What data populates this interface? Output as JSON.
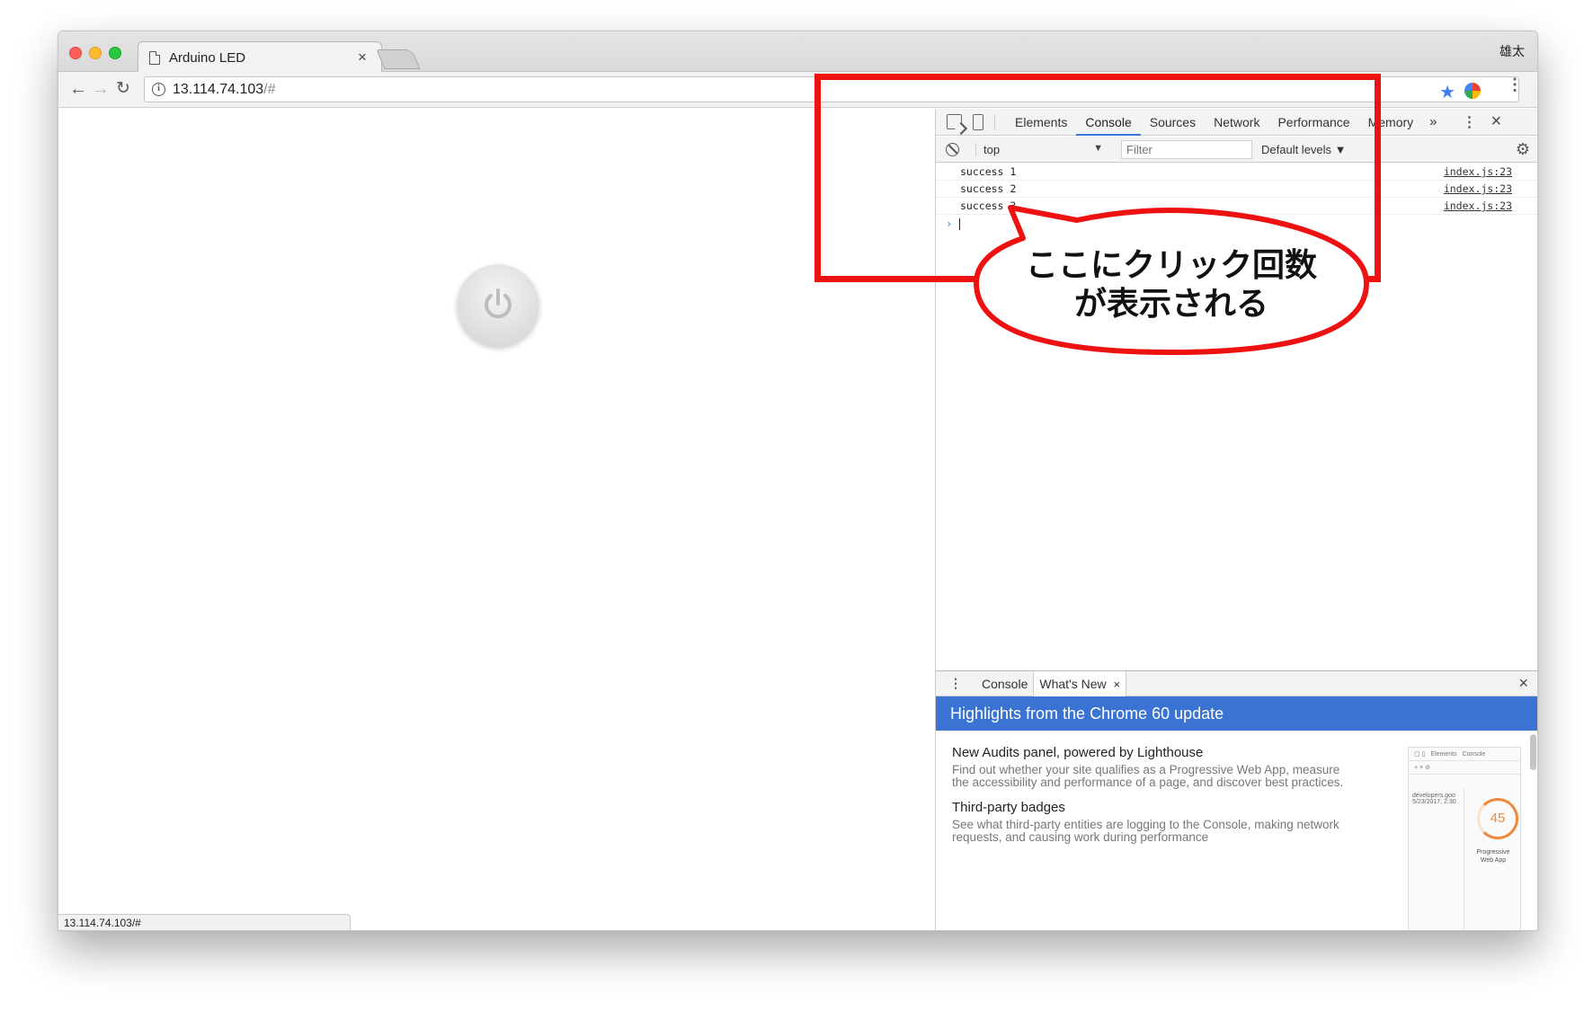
{
  "browser": {
    "tab_title": "Arduino LED",
    "tab_close": "×",
    "profile_name": "雄太",
    "url_host": "13.114.74.103",
    "url_rest": "/#",
    "status_url": "13.114.74.103/#"
  },
  "devtools": {
    "tabs": [
      "Elements",
      "Console",
      "Sources",
      "Network",
      "Performance",
      "Memory"
    ],
    "more_tabs": "»",
    "active_tab": "Console",
    "close": "×",
    "context": "top",
    "filter_placeholder": "Filter",
    "levels_label": "Default levels ▼",
    "log": [
      {
        "message": "success 1",
        "source": "index.js:23"
      },
      {
        "message": "success 2",
        "source": "index.js:23"
      },
      {
        "message": "success 3",
        "source": "index.js:23"
      }
    ],
    "prompt": "›"
  },
  "drawer": {
    "tab_console": "Console",
    "tab_whats_new": "What's New",
    "tab_x": "×",
    "close": "×",
    "banner": "Highlights from the Chrome 60 update",
    "items": [
      {
        "title": "New Audits panel, powered by Lighthouse",
        "desc": "Find out whether your site qualifies as a Progressive Web App, measure the accessibility and performance of a page, and discover best practices."
      },
      {
        "title": "Third-party badges",
        "desc": "See what third-party entities are logging to the Console, making network requests, and causing work during performance"
      }
    ],
    "thumb": {
      "tab_a": "Elements",
      "tab_b": "Console",
      "side_text": "developers.goo",
      "side_date": "5/23/2017, 2:30",
      "score": "45",
      "score_label": "Progressive Web App"
    }
  },
  "annotation": {
    "line1": "ここにクリック回数",
    "line2": "が表示される",
    "color": "#ee1111"
  }
}
